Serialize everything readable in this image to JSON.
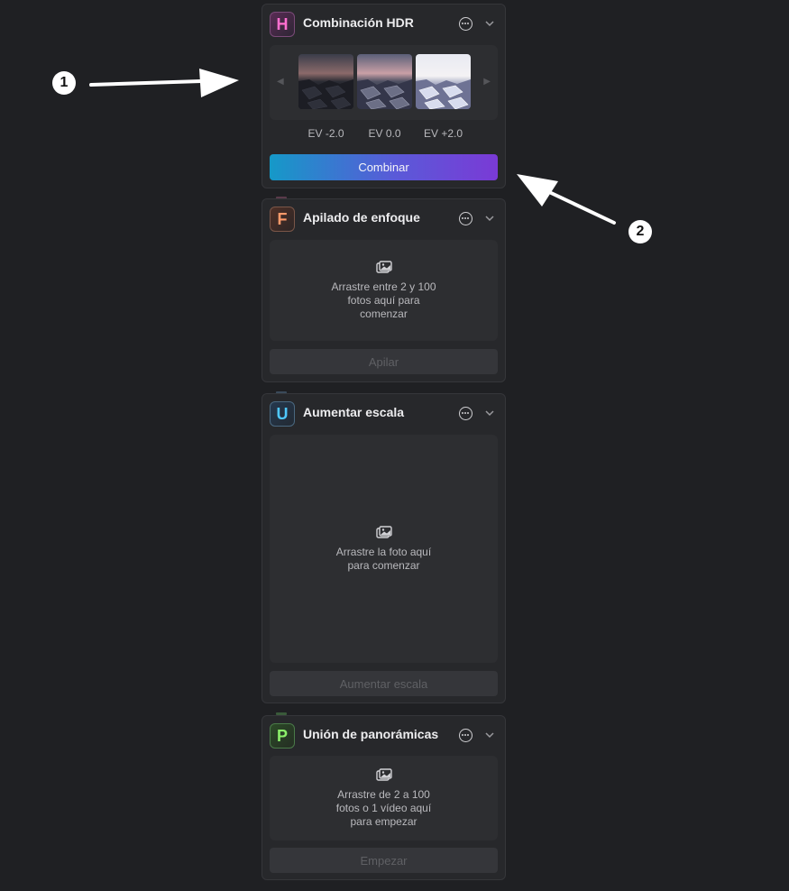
{
  "panels": {
    "hdr": {
      "icon_letter": "H",
      "title": "Combinación HDR",
      "ev_labels": [
        "EV -2.0",
        "EV 0.0",
        "EV +2.0"
      ],
      "button": "Combinar"
    },
    "focus": {
      "icon_letter": "F",
      "title": "Apilado de enfoque",
      "drop_text": "Arrastre entre 2 y 100\nfotos aquí para\ncomenzar",
      "button": "Apilar"
    },
    "upscale": {
      "icon_letter": "U",
      "title": "Aumentar escala",
      "drop_text": "Arrastre la foto aquí\npara comenzar",
      "button": "Aumentar escala"
    },
    "panorama": {
      "icon_letter": "P",
      "title": "Unión de panorámicas",
      "drop_text": "Arrastre de 2 a 100\nfotos o 1 vídeo aquí\npara empezar",
      "button": "Empezar"
    }
  },
  "callouts": [
    "1",
    "2"
  ],
  "icons": {
    "more": "more-icon",
    "chevron": "chevron-down-icon",
    "photo": "photo-icon",
    "arrow_left": "arrow-left-icon",
    "arrow_right": "arrow-right-icon"
  },
  "colors": {
    "background": "#1f2023",
    "panel": "#27282b",
    "button_gradient_start": "#1599c8",
    "button_gradient_end": "#7a3ad6"
  }
}
